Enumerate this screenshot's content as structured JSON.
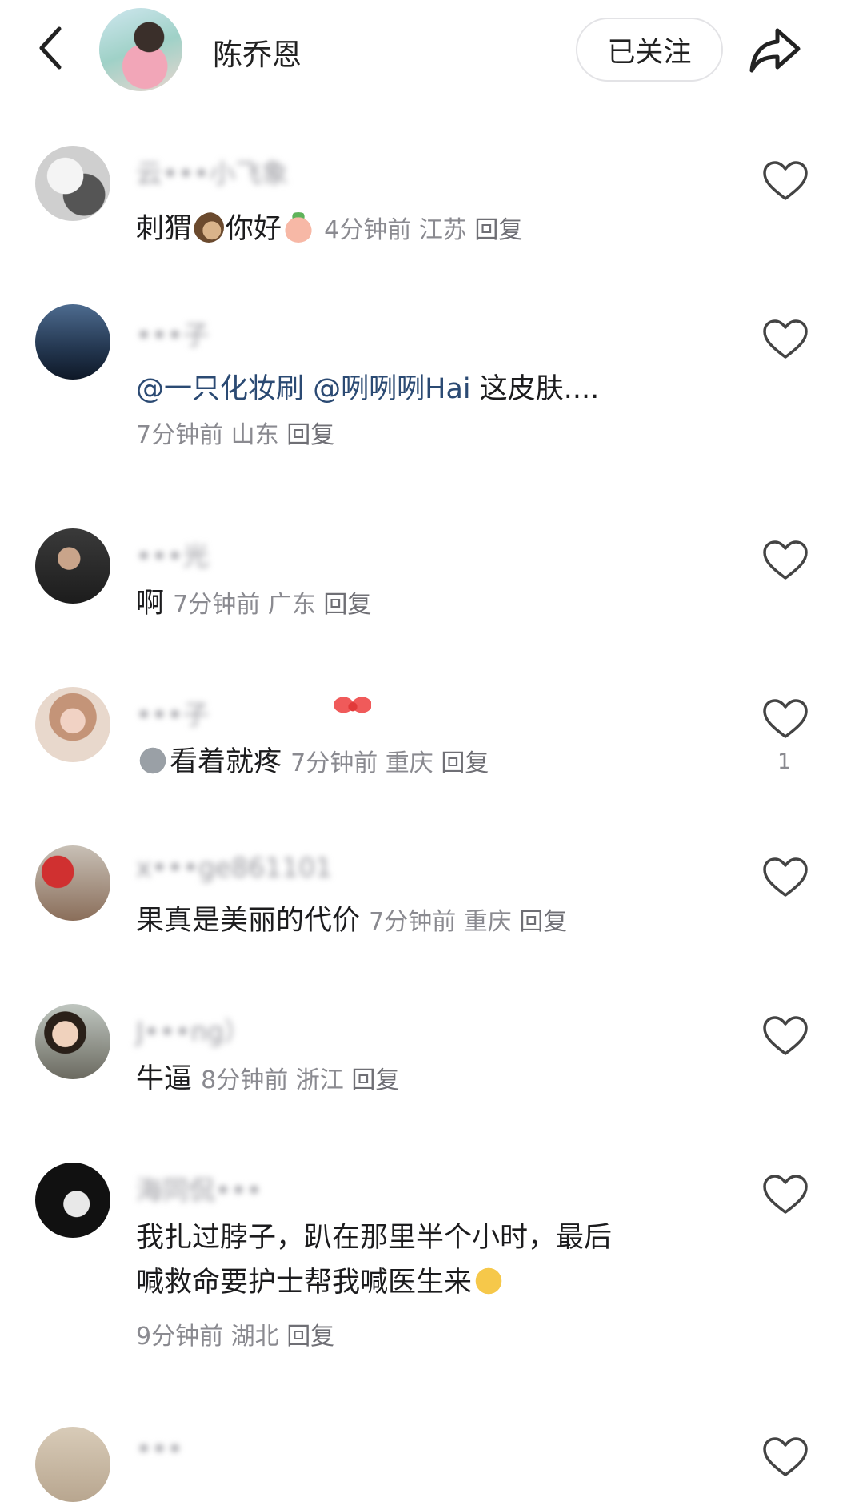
{
  "header": {
    "title": "陈乔恩",
    "follow_label": "已关注"
  },
  "comments": [
    {
      "name": "云•••小飞象",
      "body": "刺猬",
      "body_mid": "你好",
      "time": "4分钟前",
      "location": "江苏",
      "reply": "回复"
    },
    {
      "name": "•••子",
      "mention1": "@一只化妆刷",
      "mention2": "@咧咧咧Hai",
      "body": "这皮肤....",
      "time": "7分钟前",
      "location": "山东",
      "reply": "回复"
    },
    {
      "name": "•••光",
      "body": "啊",
      "time": "7分钟前",
      "location": "广东",
      "reply": "回复"
    },
    {
      "name": "•••子",
      "body": "看着就疼",
      "time": "7分钟前",
      "location": "重庆",
      "reply": "回复",
      "likes": "1"
    },
    {
      "name": "x•••ge861101",
      "body": "果真是美丽的代价",
      "time": "7分钟前",
      "location": "重庆",
      "reply": "回复"
    },
    {
      "name": "J•••ng）",
      "body": "牛逼",
      "time": "8分钟前",
      "location": "浙江",
      "reply": "回复"
    },
    {
      "name": "海同侃•••",
      "body_line1": "我扎过脖子，趴在那里半个小时，最后",
      "body_line2": "喊救命要护士帮我喊医生来",
      "time": "9分钟前",
      "location": "湖北",
      "reply": "回复"
    },
    {
      "name": "•••"
    }
  ]
}
